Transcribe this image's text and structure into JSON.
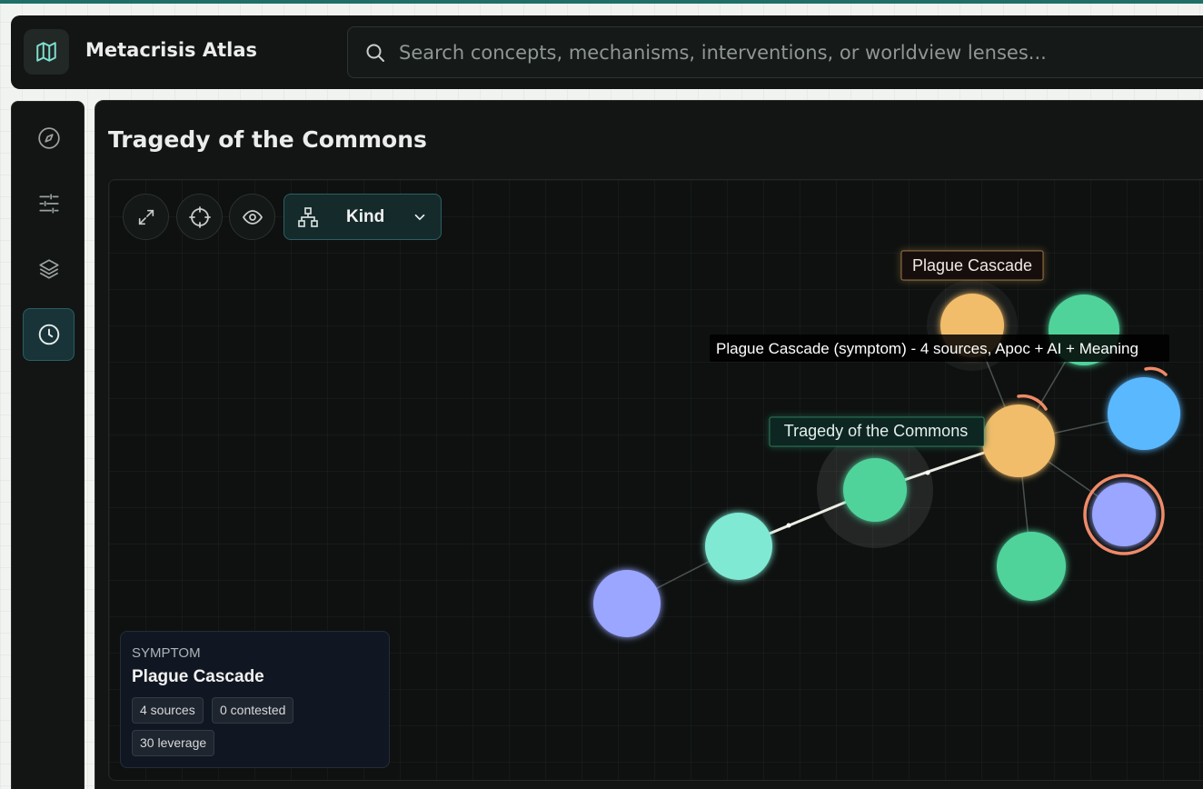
{
  "app": {
    "title": "Metacrisis Atlas",
    "logo_icon": "map-icon"
  },
  "search": {
    "placeholder": "Search concepts, mechanisms, interventions, or worldview lenses...",
    "value": ""
  },
  "sidebar": {
    "items": [
      {
        "icon": "compass-icon",
        "active": false
      },
      {
        "icon": "sliders-icon",
        "active": false
      },
      {
        "icon": "layers-icon",
        "active": false
      },
      {
        "icon": "clock-icon",
        "active": true
      }
    ]
  },
  "panel": {
    "title": "Tragedy of the Commons"
  },
  "toolbar": {
    "buttons": [
      "expand-icon",
      "crosshair-icon",
      "eye-icon"
    ],
    "group_by": {
      "icon": "hierarchy-icon",
      "label": "Kind",
      "chevron": "chevron-down-icon"
    }
  },
  "graph": {
    "labels": {
      "hover_node": "Plague Cascade",
      "tooltip": "Plague Cascade (symptom) - 4 sources, Apoc + AI + Meaning",
      "selected_node": "Tragedy of the Commons"
    },
    "colors": {
      "symptom": "#f2bd6b",
      "mechanism": "#4fd39b",
      "mint": "#7fe9d4",
      "lens": "#9aa6ff",
      "blue": "#5ab8ff",
      "ring": "#f08a66"
    }
  },
  "info_card": {
    "kind": "SYMPTOM",
    "name": "Plague Cascade",
    "chips": [
      "4 sources",
      "0 contested",
      "30 leverage"
    ]
  }
}
